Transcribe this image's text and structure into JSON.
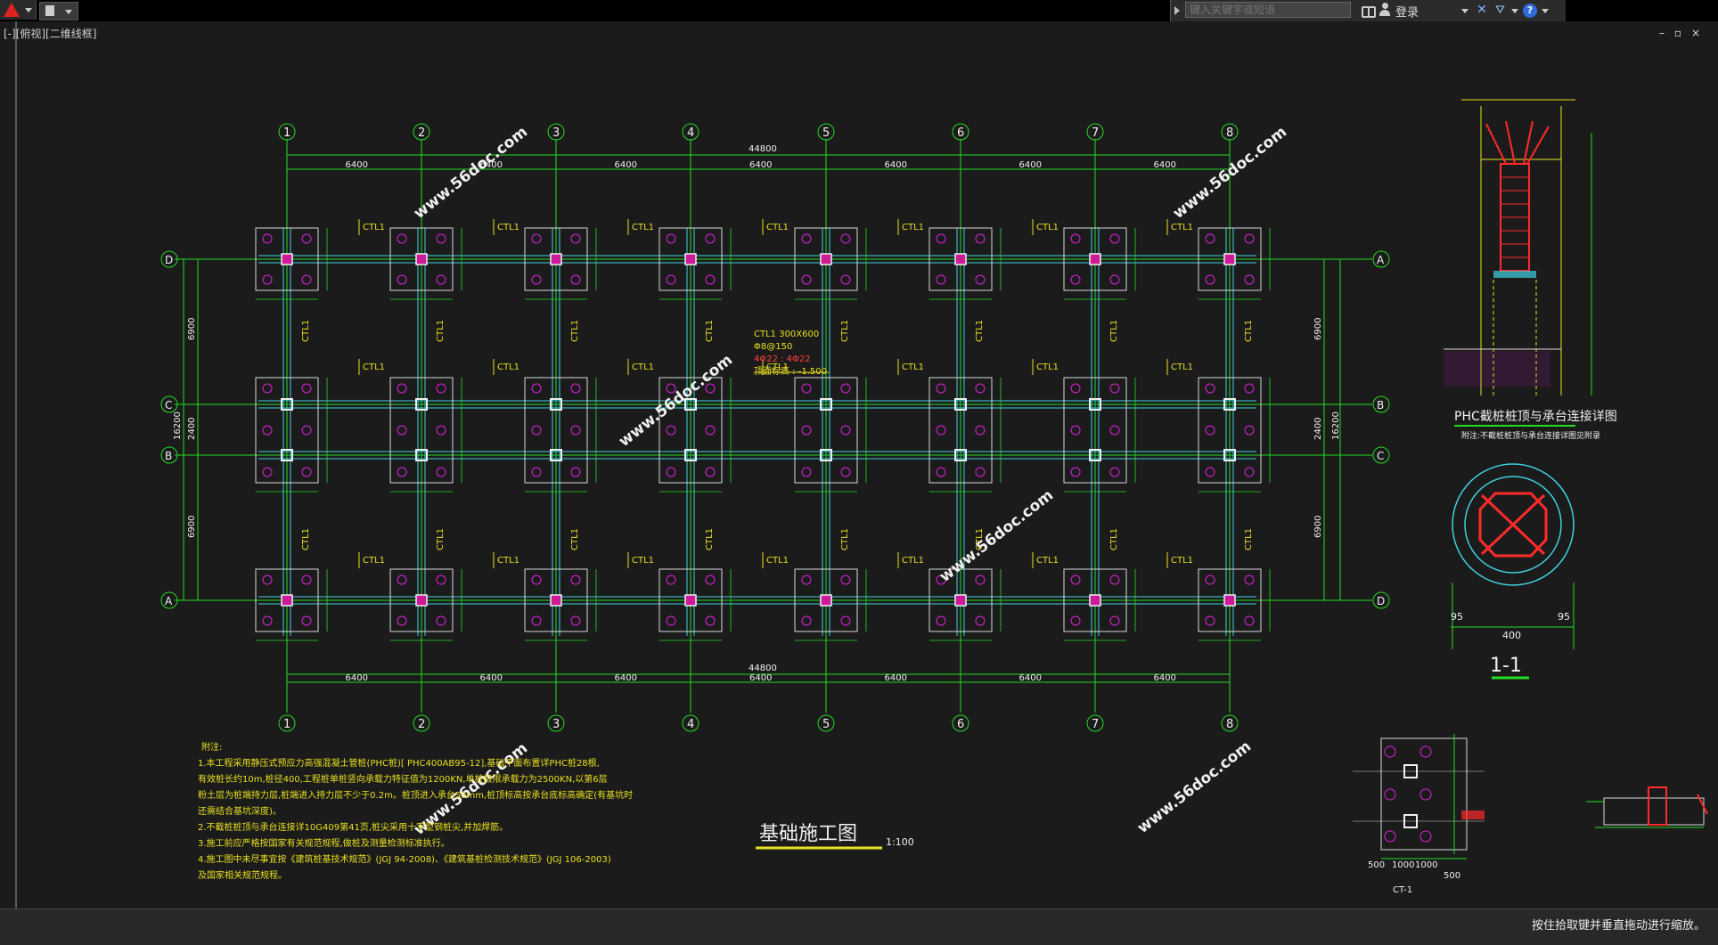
{
  "toolbar": {
    "search_placeholder": "键入关键字或短语",
    "login_label": "登录"
  },
  "viewport": {
    "label": "[-][俯视][二维线框]",
    "controls": [
      "–",
      "▫",
      "×"
    ]
  },
  "status": {
    "text": "按住拾取键并垂直拖动进行缩放。"
  },
  "drawing": {
    "title": "基础施工图",
    "scale": "1:100",
    "total_dim": "44800",
    "bay_dim": "6400",
    "axis_numbers": [
      "1",
      "2",
      "3",
      "4",
      "5",
      "6",
      "7",
      "8"
    ],
    "left_axes": [
      "D",
      "C",
      "B",
      "A"
    ],
    "right_axes": [
      "A",
      "B",
      "C",
      "D"
    ],
    "left_dims": [
      "6900",
      "2400",
      "6900"
    ],
    "left_total": "16200",
    "cap_label": "CTL1",
    "beam_note": [
      "CTL1 300X600",
      "Φ8@150",
      "4Φ22 : 4Φ22",
      "顶面标高 : -1.500"
    ],
    "watermark": "www.56doc.com",
    "notes": [
      "附注:",
      "1.本工程采用静压式预应力高强混凝土管桩(PHC桩)[ PHC400AB95-12],基础平面布置详PHC桩28根,",
      "有效桩长约10m,桩径400,工程桩单桩竖向承载力特征值为1200KN,单桩极限承载力为2500KN,以第6层",
      "粉土层为桩端持力层,桩端进入持力层不少于0.2m。桩顶进入承台50mm,桩顶标高按承台底标高确定(有基坑时",
      "还需结合基坑深度)。",
      "2.不截桩桩顶与承台连接详10G409第41页,桩尖采用十字型钢桩尖,并加焊筋。",
      "3.施工前应严格按国家有关规范规程,做桩及测量检测标准执行。",
      "4.施工图中未尽事宜按《建筑桩基技术规范》(JGJ 94-2008)、《建筑基桩检测技术规范》(JGJ 106-2003)",
      "及国家相关规范规程。"
    ],
    "detail_title": "PHC截桩桩顶与承台连接详图",
    "detail_note": "附注:不截桩桩顶与承台连接详图见附录",
    "section_title": "1-1",
    "section_dims": [
      "95",
      "400",
      "95"
    ],
    "ct_label": "CT-1",
    "ct_dims": [
      "500",
      "1000",
      "1000",
      "500"
    ],
    "colors": {
      "grid": "#22dd22",
      "beam": "#40d0e0",
      "cap": "#d8d8d8",
      "pile": "#e020e0",
      "label": "#e8e020",
      "watermark": "#f0f0f0",
      "red": "#ff2a2a"
    }
  }
}
